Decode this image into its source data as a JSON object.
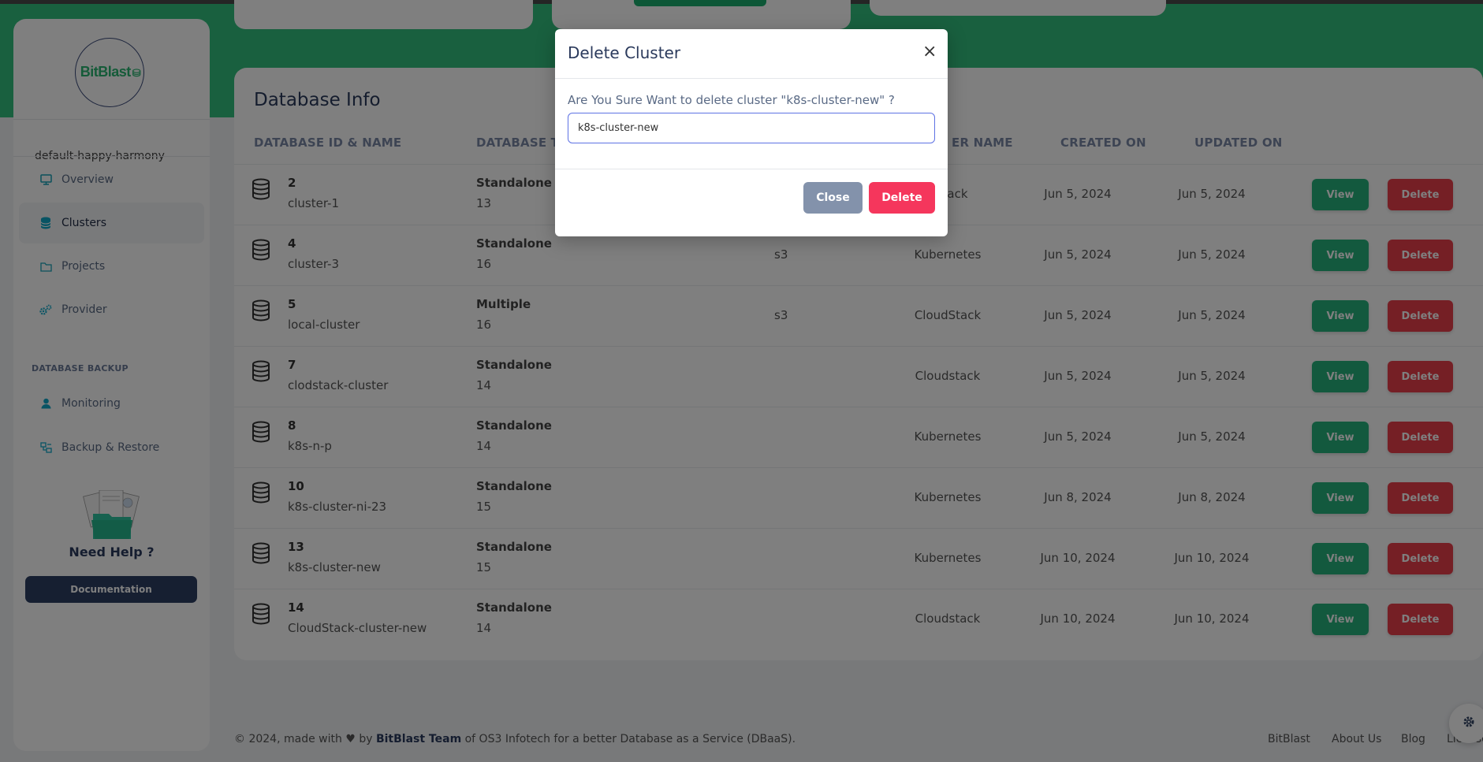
{
  "brand": {
    "name": "BitBlast"
  },
  "sidebar": {
    "org_name": "default-happy-harmony",
    "items": [
      {
        "label": "Overview",
        "icon": "monitor-icon"
      },
      {
        "label": "Clusters",
        "icon": "database-icon",
        "active": true
      },
      {
        "label": "Projects",
        "icon": "folder-icon"
      },
      {
        "label": "Provider",
        "icon": "gears-icon"
      }
    ],
    "section_label": "DATABASE BACKUP",
    "backup_items": [
      {
        "label": "Monitoring",
        "icon": "user-icon"
      },
      {
        "label": "Backup & Restore",
        "icon": "backup-icon"
      }
    ],
    "help_title": "Need Help ?",
    "doc_button": "Documentation"
  },
  "main": {
    "title": "Database Info",
    "columns": [
      "DATABASE ID & NAME",
      "DATABASE TY",
      "ER NAME",
      "CREATED ON",
      "UPDATED ON"
    ],
    "view_label": "View",
    "delete_label": "Delete",
    "rows": [
      {
        "id": "2",
        "name": "cluster-1",
        "type": "Standalone",
        "version": "13",
        "storage": "",
        "provider": "dStack",
        "created": "Jun 5, 2024",
        "updated": "Jun 5, 2024"
      },
      {
        "id": "4",
        "name": "cluster-3",
        "type": "Standalone",
        "version": "16",
        "storage": "s3",
        "provider": "Kubernetes",
        "created": "Jun 5, 2024",
        "updated": "Jun 5, 2024"
      },
      {
        "id": "5",
        "name": "local-cluster",
        "type": "Multiple",
        "version": "16",
        "storage": "s3",
        "provider": "CloudStack",
        "created": "Jun 5, 2024",
        "updated": "Jun 5, 2024"
      },
      {
        "id": "7",
        "name": "clodstack-cluster",
        "type": "Standalone",
        "version": "14",
        "storage": "",
        "provider": "Cloudstack",
        "created": "Jun 5, 2024",
        "updated": "Jun 5, 2024"
      },
      {
        "id": "8",
        "name": "k8s-n-p",
        "type": "Standalone",
        "version": "14",
        "storage": "",
        "provider": "Kubernetes",
        "created": "Jun 5, 2024",
        "updated": "Jun 5, 2024"
      },
      {
        "id": "10",
        "name": "k8s-cluster-ni-23",
        "type": "Standalone",
        "version": "15",
        "storage": "",
        "provider": "Kubernetes",
        "created": "Jun 8, 2024",
        "updated": "Jun 8, 2024"
      },
      {
        "id": "13",
        "name": "k8s-cluster-new",
        "type": "Standalone",
        "version": "15",
        "storage": "",
        "provider": "Kubernetes",
        "created": "Jun 10, 2024",
        "updated": "Jun 10, 2024"
      },
      {
        "id": "14",
        "name": "CloudStack-cluster-new",
        "type": "Standalone",
        "version": "14",
        "storage": "",
        "provider": "Cloudstack",
        "created": "Jun 10, 2024",
        "updated": "Jun 10, 2024"
      }
    ]
  },
  "footer": {
    "prefix": "© 2024, made with",
    "by": "by",
    "team": "BitBlast Team",
    "suffix": "of OS3 Infotech for a better Database as a Service (DBaaS).",
    "links": [
      "BitBlast",
      "About Us",
      "Blog",
      "License"
    ]
  },
  "modal": {
    "title": "Delete Cluster",
    "close_x": "×",
    "question": "Are You Sure Want to delete cluster \"k8s-cluster-new\" ?",
    "input_value": "k8s-cluster-new",
    "close_label": "Close",
    "delete_label": "Delete"
  },
  "colors": {
    "accent_green": "#33c17f",
    "view_button": "#26b37c",
    "delete_button": "#ea3e4a",
    "modal_delete": "#f5365c",
    "modal_close": "#8392ab",
    "doc_button": "#2c3e63"
  }
}
